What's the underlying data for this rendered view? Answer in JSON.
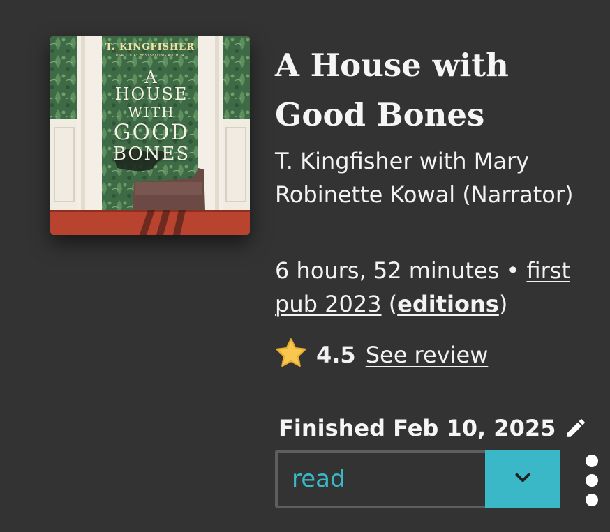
{
  "cover": {
    "author": "T. KINGFISHER",
    "tagline": "USA TODAY BESTSELLING AUTHOR",
    "title_lines": [
      "A HOUSE",
      "WITH",
      "GOOD",
      "BONES"
    ]
  },
  "book": {
    "title": "A House with Good Bones",
    "contributors": "T. Kingfisher with Mary Robinette Kowal (Narrator)",
    "duration": "6 hours, 52 minutes",
    "separator": " • ",
    "first_pub": "first pub 2023",
    "editions_open": " (",
    "editions": "editions",
    "editions_close": ")"
  },
  "rating": {
    "icon": "star-icon",
    "value": "4.5",
    "review_link": "See review",
    "star_color": "#f9c74f"
  },
  "reading": {
    "finished": "Finished Feb 10, 2025",
    "edit_icon": "pencil-icon",
    "status": "read",
    "dropdown_icon": "chevron-down-icon",
    "menu_icon": "more-vertical-icon"
  },
  "colors": {
    "background": "#333333",
    "accent": "#3ab8c8",
    "text": "#f2f2f2"
  }
}
